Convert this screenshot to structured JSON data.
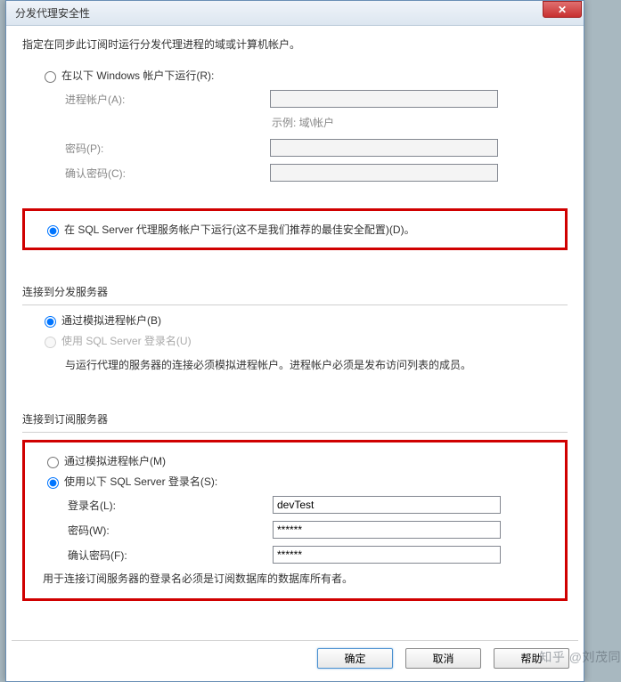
{
  "title": "分发代理安全性",
  "close_label": "✕",
  "instruction": "指定在同步此订阅时运行分发代理进程的域或计算机帐户。",
  "run_under": {
    "windows_label": "在以下 Windows 帐户下运行(R):",
    "process_account_label": "进程帐户(A):",
    "example_hint": "示例: 域\\帐户",
    "password_label": "密码(P):",
    "confirm_password_label": "确认密码(C):",
    "sql_agent_label": "在 SQL Server 代理服务帐户下运行(这不是我们推荐的最佳安全配置)(D)。"
  },
  "distributor": {
    "section_title": "连接到分发服务器",
    "impersonate_label": "通过模拟进程帐户(B)",
    "sql_login_label": "使用 SQL Server 登录名(U)",
    "note": "与运行代理的服务器的连接必须模拟进程帐户。进程帐户必须是发布访问列表的成员。"
  },
  "subscriber": {
    "section_title": "连接到订阅服务器",
    "impersonate_label": "通过模拟进程帐户(M)",
    "sql_login_label": "使用以下 SQL Server 登录名(S):",
    "login_label": "登录名(L):",
    "login_value": "devTest",
    "password_label": "密码(W):",
    "password_value": "******",
    "confirm_label": "确认密码(F):",
    "confirm_value": "******",
    "note": "用于连接订阅服务器的登录名必须是订阅数据库的数据库所有者。"
  },
  "buttons": {
    "ok": "确定",
    "cancel": "取消",
    "help": "帮助"
  },
  "watermark": "知乎 @刘茂同"
}
